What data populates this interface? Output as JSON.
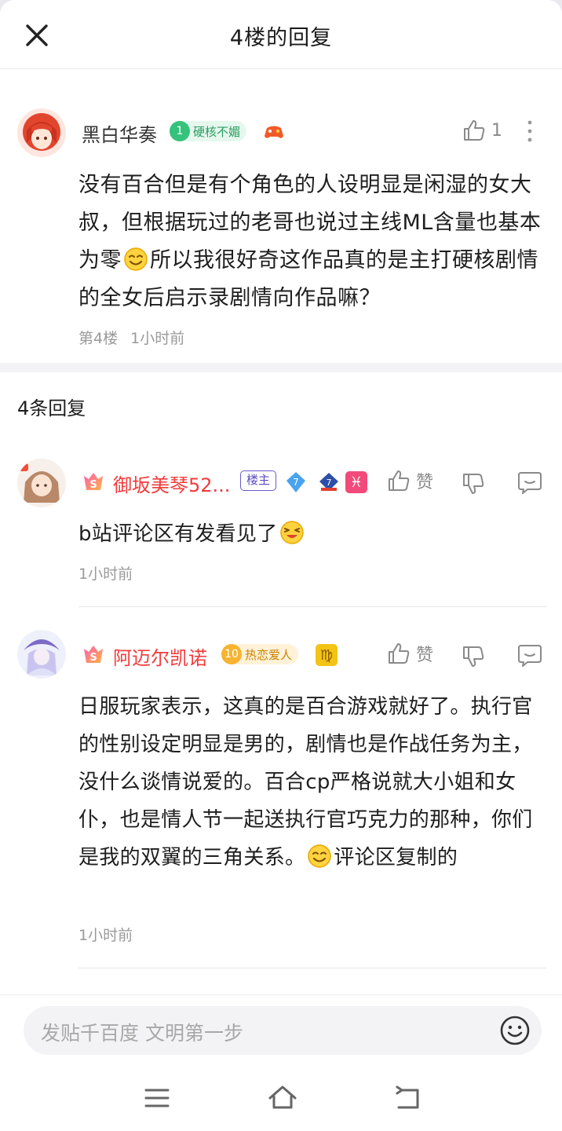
{
  "header": {
    "title": "4楼的回复"
  },
  "post": {
    "username": "黑白华奏",
    "badge_level": "1",
    "badge_text": "硬核不媚",
    "likes": "1",
    "text_before_emoji": "没有百合但是有个角色的人设明显是闲湿的女大叔，但根据玩过的老哥也说过主线ML含量也基本为零",
    "text_after_emoji": "所以我很好奇这作品真的是主打硬核剧情的全女后启示录剧情向作品嘛？",
    "floor": "第4楼",
    "time": "1小时前"
  },
  "reply_count": "4条回复",
  "replies": [
    {
      "username": "御坂美琴52...",
      "owner_tag": "楼主",
      "level": "7",
      "like_label": "赞",
      "text": "b站评论区有发看见了",
      "time": "1小时前"
    },
    {
      "username": "阿迈尔凯诺",
      "badge_level": "10",
      "badge_text": "热恋爱人",
      "like_label": "赞",
      "text_before_emoji": "日服玩家表示，这真的是百合游戏就好了。执行官的性别设定明显是男的，剧情也是作战任务为主，没什么谈情说爱的。百合cp严格说就大小姐和女仆，也是情人节一起送执行官巧克力的那种，你们是我的双翼的三角关系。",
      "text_after_emoji": "评论区复制的",
      "time": "1小时前"
    }
  ],
  "input": {
    "placeholder": "发贴千百度 文明第一步"
  },
  "colors": {
    "username_red": "#f23b3b",
    "badge_green": "#35c27a",
    "badge_orange": "#f6b431",
    "owner_purple": "#5b4bc4"
  }
}
